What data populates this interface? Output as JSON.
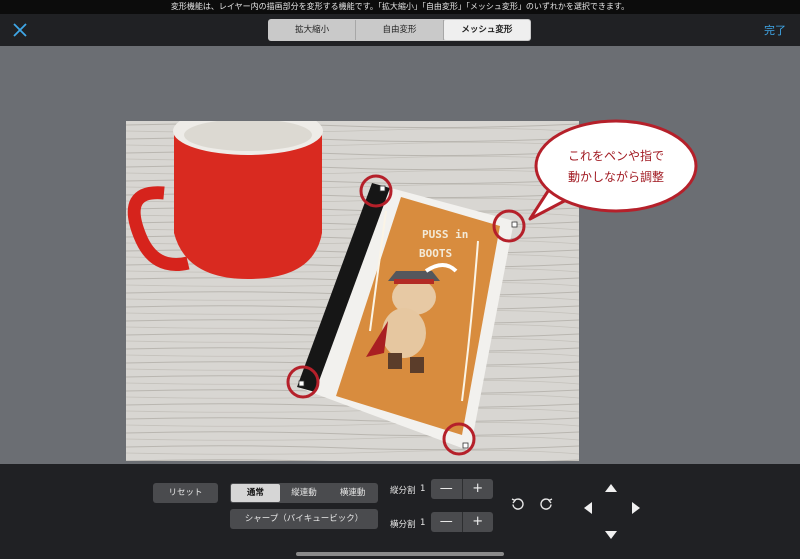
{
  "status_bar": {
    "message": "変形機能は、レイヤー内の描画部分を変形する機能です。「拡大縮小」「自由変形」「メッシュ変形」のいずれかを選択できます。"
  },
  "top_bar": {
    "close_icon": "close-icon",
    "transform_tabs": [
      {
        "label": "拡大縮小",
        "active": false
      },
      {
        "label": "自由変形",
        "active": false
      },
      {
        "label": "メッシュ変形",
        "active": true
      }
    ],
    "done_label": "完了",
    "accent": "#3fa7e8"
  },
  "canvas": {
    "book": {
      "title_line1": "PUSS in",
      "title_line2": "BOOTS"
    },
    "callout": {
      "line1": "これをペンや指で",
      "line2": "動かしながら調整"
    },
    "handle_color": "#b5202a"
  },
  "bottom_bar": {
    "reset_label": "リセット",
    "mode_options": [
      {
        "label": "通常",
        "active": true
      },
      {
        "label": "縦連動",
        "active": false
      },
      {
        "label": "横連動",
        "active": false
      }
    ],
    "interpolation_label": "シャープ（バイキュービック）",
    "vertical_division": {
      "label": "縦分割",
      "value": "1",
      "minus": "—",
      "plus": "+"
    },
    "horizontal_division": {
      "label": "横分割",
      "value": "1",
      "minus": "—",
      "plus": "+"
    },
    "undo_icon": "rotate-left-icon",
    "redo_icon": "rotate-right-icon",
    "nudge_icons": [
      "arrow-up-icon",
      "arrow-left-icon",
      "arrow-right-icon",
      "arrow-down-icon"
    ]
  }
}
